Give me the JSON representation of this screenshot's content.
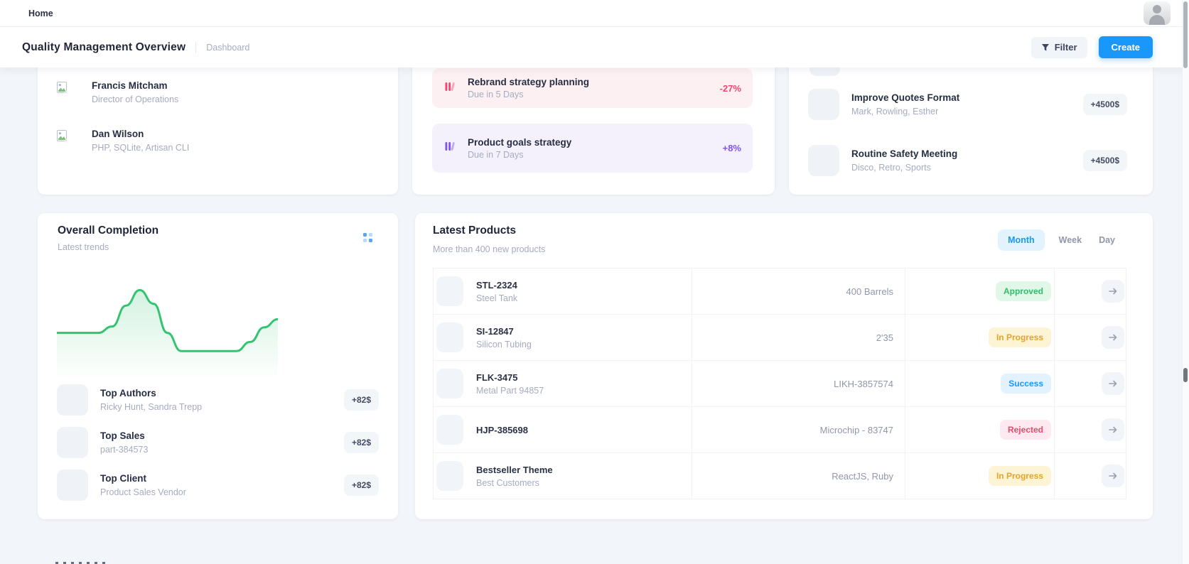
{
  "topbar": {
    "home_label": "Home"
  },
  "header": {
    "title": "Quality Management Overview",
    "breadcrumb": "Dashboard",
    "filter_label": "Filter",
    "create_label": "Create"
  },
  "team_card": {
    "members": [
      {
        "name": "Francis Mitcham",
        "role": "Director of Operations"
      },
      {
        "name": "Dan Wilson",
        "role": "PHP, SQLite, Artisan CLI"
      }
    ]
  },
  "tasks_card": {
    "items": [
      {
        "title": "Rebrand strategy planning",
        "due": "Due in 5 Days",
        "change": "-27%",
        "accent": "#f3466f"
      },
      {
        "title": "Product goals strategy",
        "due": "Due in 7 Days",
        "change": "+8%",
        "accent": "#7d53f5"
      }
    ]
  },
  "meetings_card": {
    "items": [
      {
        "title": "Improve Quotes Format",
        "people": "Mark, Rowling, Esther",
        "amount": "+4500$"
      },
      {
        "title": "Routine Safety Meeting",
        "people": "Disco, Retro, Sports",
        "amount": "+4500$"
      }
    ]
  },
  "completion_card": {
    "title": "Overall Completion",
    "subtitle": "Latest trends",
    "chart_data": {
      "type": "area",
      "values": [
        48,
        48,
        48,
        48,
        55,
        78,
        95,
        80,
        48,
        28,
        28,
        28,
        28,
        28,
        38,
        54,
        63
      ],
      "ylim": [
        0,
        100
      ],
      "color": "#34c471",
      "grid": false,
      "axes_hidden": true
    },
    "items": [
      {
        "title": "Top Authors",
        "subtitle": "Ricky Hunt, Sandra Trepp",
        "amount": "+82$"
      },
      {
        "title": "Top Sales",
        "subtitle": "part-384573",
        "amount": "+82$"
      },
      {
        "title": "Top Client",
        "subtitle": "Product Sales Vendor",
        "amount": "+82$"
      }
    ]
  },
  "products_card": {
    "title": "Latest Products",
    "subtitle": "More than 400 new products",
    "tabs": [
      "Month",
      "Week",
      "Day"
    ],
    "active_tab": "Month",
    "rows": [
      {
        "code": "STL-2324",
        "name": "Steel Tank",
        "value": "400 Barrels",
        "status": "Approved",
        "status_kind": "green"
      },
      {
        "code": "SI-12847",
        "name": "Silicon Tubing",
        "value": "2'35",
        "status": "In Progress",
        "status_kind": "yellow"
      },
      {
        "code": "FLK-3475",
        "name": "Metal Part 94857",
        "value": "LIKH-3857574",
        "status": "Success",
        "status_kind": "blue"
      },
      {
        "code": "HJP-385698",
        "name": "",
        "value": "Microchip - 83747",
        "status": "Rejected",
        "status_kind": "red"
      },
      {
        "code": "Bestseller Theme",
        "name": "Best Customers",
        "value": "ReactJS, Ruby",
        "status": "In Progress",
        "status_kind": "yellow"
      }
    ]
  },
  "colors": {
    "accent_blue": "#1a97fa",
    "chart_green": "#34c471",
    "status_green": "#2ebd6b",
    "status_yellow": "#e2a42c",
    "status_red": "#f3466f",
    "task_purple": "#7d53f5",
    "page_background": "#f2f5f9"
  }
}
